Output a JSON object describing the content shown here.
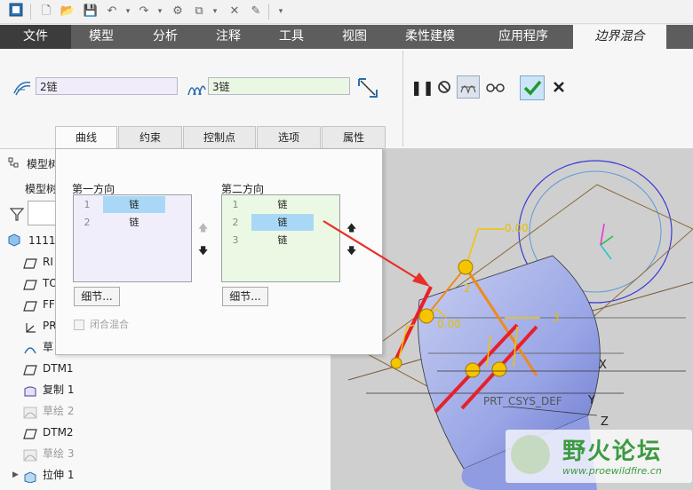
{
  "ribbon_tabs": [
    "文件",
    "模型",
    "分析",
    "注释",
    "工具",
    "视图",
    "柔性建模",
    "应用程序",
    "边界混合"
  ],
  "ribbon": {
    "first_chain": "2链",
    "second_chain": "3链"
  },
  "sub_tabs": [
    "曲线",
    "约束",
    "控制点",
    "选项",
    "属性"
  ],
  "panel": {
    "first_dir": {
      "title": "第一方向",
      "rows": [
        {
          "n": "1",
          "label": "链"
        },
        {
          "n": "2",
          "label": "链"
        }
      ],
      "details": "细节..."
    },
    "second_dir": {
      "title": "第二方向",
      "rows": [
        {
          "n": "1",
          "label": "链"
        },
        {
          "n": "2",
          "label": "链"
        },
        {
          "n": "3",
          "label": "链"
        }
      ],
      "details": "细节..."
    },
    "closed_blend": "闭合混合"
  },
  "tree": {
    "header": "模型树",
    "header_partial": "模型树",
    "part": "1111.",
    "items": [
      {
        "label": "RI",
        "icon": "plane",
        "dim": false
      },
      {
        "label": "TO",
        "icon": "plane",
        "dim": false
      },
      {
        "label": "FF",
        "icon": "plane",
        "dim": false
      },
      {
        "label": "PR",
        "icon": "csys",
        "dim": false
      },
      {
        "label": "草",
        "icon": "sketch",
        "dim": false
      },
      {
        "label": "DTM1",
        "icon": "plane",
        "dim": false
      },
      {
        "label": "复制 1",
        "icon": "copy",
        "dim": false
      },
      {
        "label": "草绘 2",
        "icon": "sketch",
        "dim": true
      },
      {
        "label": "DTM2",
        "icon": "plane",
        "dim": false
      },
      {
        "label": "草绘 3",
        "icon": "sketch",
        "dim": true
      },
      {
        "label": "拉伸 1",
        "icon": "extrude",
        "dim": false
      }
    ]
  },
  "viewport": {
    "dim_top": "0.00",
    "dim_mid": "0.00",
    "label_2": "2",
    "label_3": "3",
    "axis_x": "X",
    "axis_y": "Y",
    "axis_z": "Z",
    "csys": "PRT_CSYS_DEF",
    "watermark_title": "野火论坛",
    "watermark_url": "www.proewildfire.cn"
  }
}
